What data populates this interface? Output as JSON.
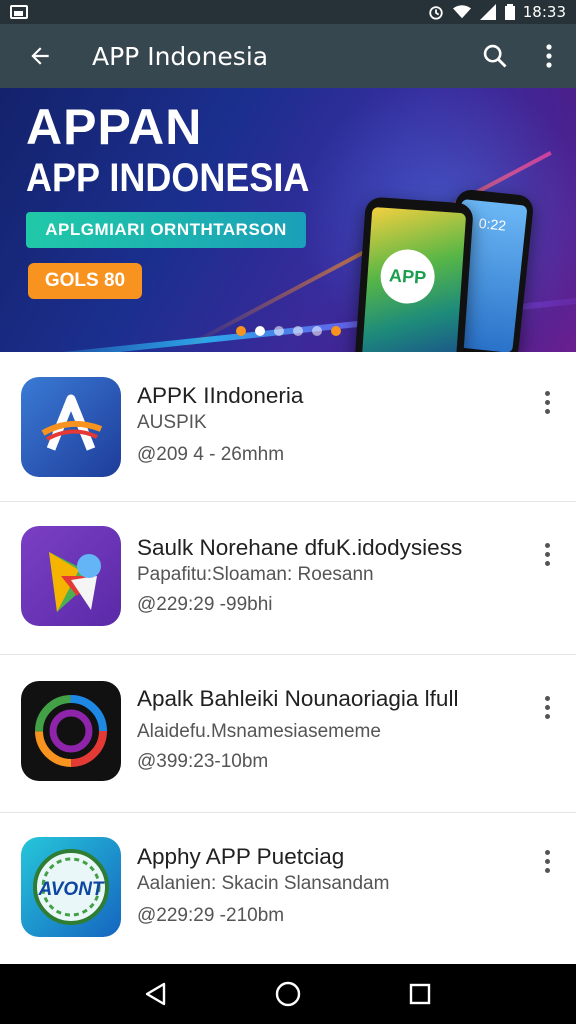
{
  "status_bar": {
    "time": "18:33"
  },
  "app_bar": {
    "title": "APP Indonesia"
  },
  "banner": {
    "headline": "APPAN",
    "subheadline": "APP INDONESIA",
    "tagline": "APLGMIARI ORNTHTARSON",
    "cta_label": "GOLS 80",
    "phone_logo_text": "APP",
    "phone_clock": "0:22",
    "carousel": {
      "count": 6,
      "active_index": 1
    }
  },
  "apps": [
    {
      "name": "APPK IIndoneria",
      "subtitle": "AUSPIK",
      "meta": "@209 4 - 26mhm",
      "icon": "app-a-icon"
    },
    {
      "name": "Saulk Norehane dfuK.idodysiess",
      "subtitle": "Papafitu:Sloaman: Roesann",
      "meta": "@229:29 -99bhi",
      "icon": "arrow-play-icon"
    },
    {
      "name": "Apalk Bahleiki Nounaoriagia lfull",
      "subtitle": "Alaidefu.Msnamesiasememe",
      "meta": "@399:23-10bm",
      "icon": "circular-arrows-icon"
    },
    {
      "name": "Apphy APP Puetciag",
      "subtitle": "Aalanien: Skacin Slansandam",
      "meta": "@229:29 -210bm",
      "icon": "avont-badge-icon",
      "icon_text": "AVONT"
    }
  ],
  "colors": {
    "app_bar": "#37474f",
    "status_bar": "#263238",
    "accent_orange": "#f7931e",
    "accent_teal": "#20c9a8"
  }
}
